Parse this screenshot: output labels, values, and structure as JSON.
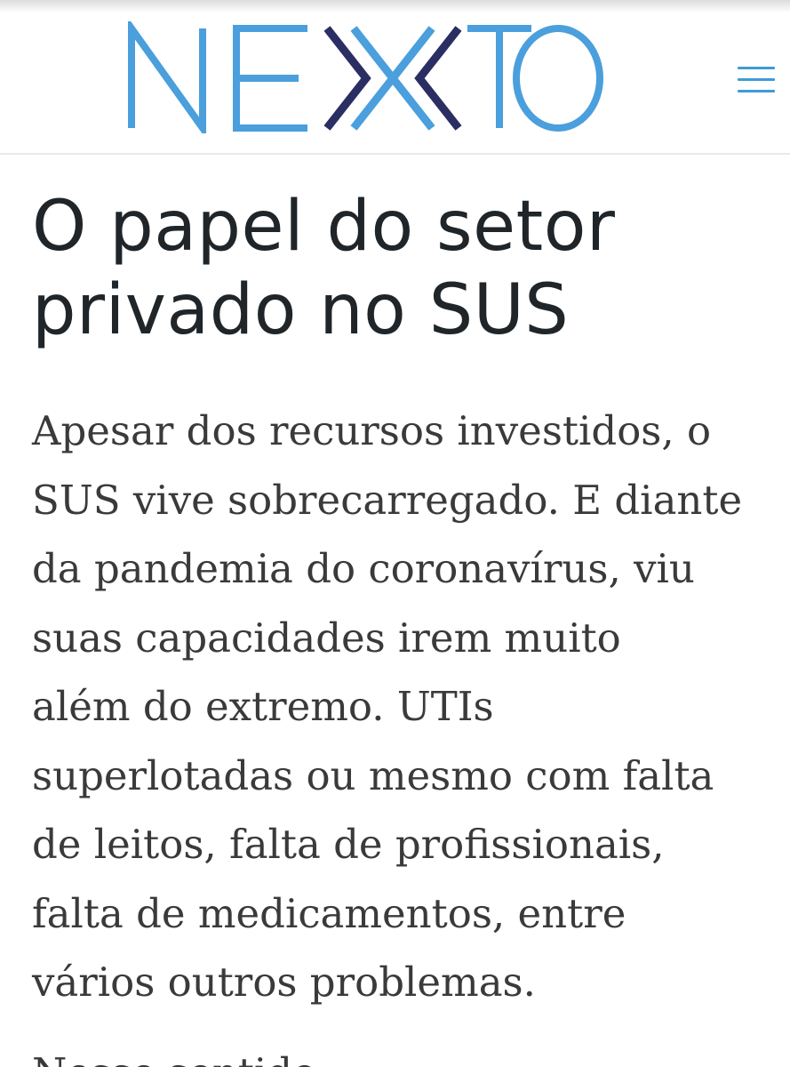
{
  "header": {
    "logo_text": "NEXXTO",
    "menu_icon": "hamburger-menu-icon",
    "colors": {
      "logo_light_blue": "#4a9fdc",
      "logo_dark_navy": "#2a2e63",
      "menu_blue": "#3f9bd8"
    }
  },
  "article": {
    "title_lines": [
      "O papel do setor",
      "privado no SUS"
    ],
    "paragraph_lines": [
      "Apesar dos recursos investidos, o",
      "SUS vive sobrecarregado. E diante",
      "da pandemia do coronavírus, viu",
      "suas capacidades irem muito",
      "além do extremo. UTIs",
      "superlotadas ou mesmo com falta",
      "de leitos, falta de profissionais,",
      "falta de medicamentos, entre",
      "vários outros problemas."
    ],
    "next_paragraph_partial": "Nesse sentido,"
  }
}
